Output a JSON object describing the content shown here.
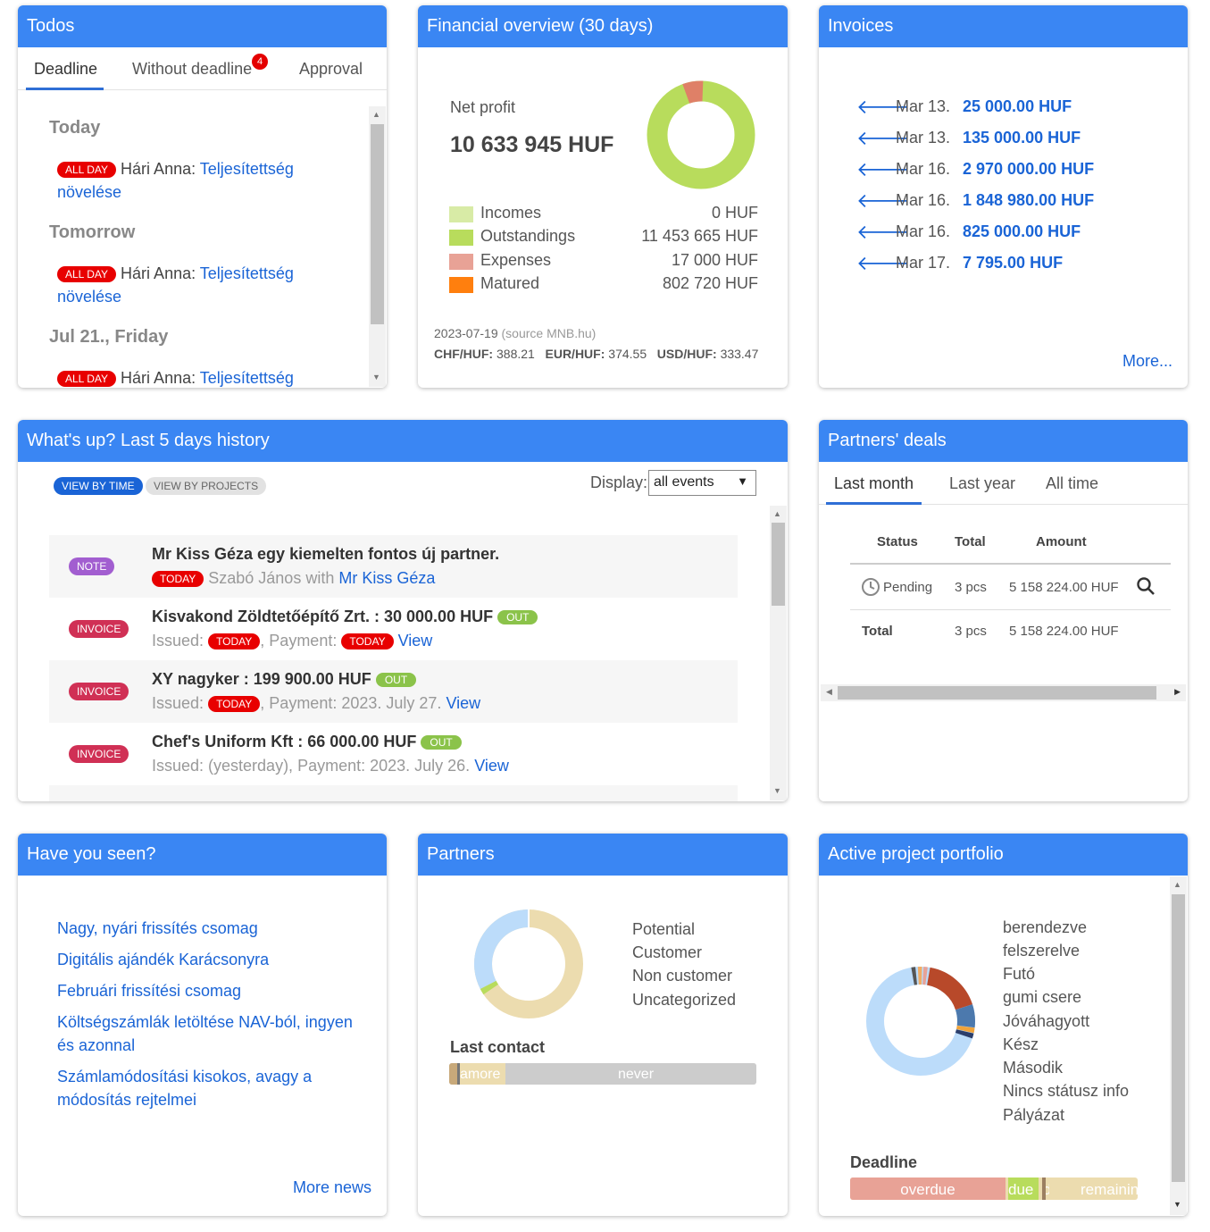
{
  "todos": {
    "title": "Todos",
    "tabs": [
      "Deadline",
      "Without deadline",
      "Approval"
    ],
    "without_deadline_badge": "4",
    "days": [
      {
        "label": "Today",
        "badge": "ALL DAY",
        "person": "Hári Anna:",
        "task": "Teljesítettség növelése"
      },
      {
        "label": "Tomorrow",
        "badge": "ALL DAY",
        "person": "Hári Anna:",
        "task": "Teljesítettség növelése"
      },
      {
        "label": "Jul 21., Friday",
        "badge": "ALL DAY",
        "person": "Hári Anna:",
        "task": "Teljesítettség"
      }
    ]
  },
  "financial": {
    "title": "Financial overview (30 days)",
    "net_profit_label": "Net profit",
    "net_profit_value": "10 633 945 HUF",
    "legend": [
      {
        "label": "Incomes",
        "value": "0 HUF",
        "color": "#d8eba6"
      },
      {
        "label": "Outstandings",
        "value": "11 453 665 HUF",
        "color": "#b8dc5c"
      },
      {
        "label": "Expenses",
        "value": "17 000 HUF",
        "color": "#e8a296"
      },
      {
        "label": "Matured",
        "value": "802 720 HUF",
        "color": "#ff7f0e"
      }
    ],
    "rate_date": "2023-07-19",
    "rate_source": "(source MNB.hu)",
    "rates": [
      {
        "pair": "CHF/HUF:",
        "value": "388.21"
      },
      {
        "pair": "EUR/HUF:",
        "value": "374.55"
      },
      {
        "pair": "USD/HUF:",
        "value": "333.47"
      }
    ]
  },
  "invoices": {
    "title": "Invoices",
    "rows": [
      {
        "date": "Mar 13.",
        "amount": "25 000.00 HUF"
      },
      {
        "date": "Mar 13.",
        "amount": "135 000.00 HUF"
      },
      {
        "date": "Mar 16.",
        "amount": "2 970 000.00 HUF"
      },
      {
        "date": "Mar 16.",
        "amount": "1 848 980.00 HUF"
      },
      {
        "date": "Mar 16.",
        "amount": "825 000.00 HUF"
      },
      {
        "date": "Mar 17.",
        "amount": "7 795.00 HUF"
      }
    ],
    "more": "More..."
  },
  "history": {
    "title": "What's up? Last 5 days history",
    "view_by_time": "VIEW BY TIME",
    "view_by_projects": "VIEW BY PROJECTS",
    "display_label": "Display:",
    "display_value": "all events",
    "events": [
      {
        "type": "NOTE",
        "title": "Mr Kiss Géza egy kiemelten fontos új partner.",
        "today": "TODAY",
        "sub_text": "Szabó János with",
        "sub_link": "Mr Kiss Géza"
      },
      {
        "type": "INVOICE",
        "title": "Kisvakond Zöldtetőépítő Zrt. : 30 000.00 HUF",
        "out": "OUT",
        "issued": "Issued:",
        "today": "TODAY",
        "payment": ", Payment:",
        "today2": "TODAY",
        "view": "View"
      },
      {
        "type": "INVOICE",
        "title": "XY nagyker : 199 900.00 HUF",
        "out": "OUT",
        "issued": "Issued:",
        "today": "TODAY",
        "payment": ", Payment: 2023. July 27.",
        "view": "View"
      },
      {
        "type": "INVOICE",
        "title": "Chef's Uniform Kft : 66 000.00 HUF",
        "out": "OUT",
        "sub_text": "Issued: (yesterday), Payment: 2023. July 26.",
        "view": "View"
      }
    ]
  },
  "deals": {
    "title": "Partners' deals",
    "tabs": [
      "Last month",
      "Last year",
      "All time"
    ],
    "headers": [
      "Status",
      "Total",
      "Amount"
    ],
    "rows": [
      {
        "status": "Pending",
        "total": "3 pcs",
        "amount": "5 158 224.00 HUF"
      }
    ],
    "total_row": {
      "label": "Total",
      "total": "3 pcs",
      "amount": "5 158 224.00 HUF"
    }
  },
  "seen": {
    "title": "Have you seen?",
    "news": [
      "Nagy, nyári frissítés csomag",
      "Digitális ajándék Karácsonyra",
      "Februári frissítési csomag",
      "Költségszámlák letöltése NAV-ból, ingyen és azonnal",
      "Számlamódosítási kisokos, avagy a módosítás rejtelmei"
    ],
    "more": "More news"
  },
  "partners": {
    "title": "Partners",
    "legend": [
      "Potential",
      "Customer",
      "Non customer",
      "Uncategorized"
    ],
    "last_contact": "Last contact",
    "bar_labels": [
      "amore",
      "never"
    ]
  },
  "portfolio": {
    "title": "Active project portfolio",
    "legend": [
      "berendezve",
      "felszerelve",
      "Futó",
      "gumi csere",
      "Jóváhagyott",
      "Kész",
      "Második",
      "Nincs státusz info",
      "Pályázat"
    ],
    "deadline": "Deadline",
    "bar_labels": [
      "overdue",
      "due",
      "d",
      "remainin"
    ]
  },
  "colors": {
    "header": "#3a86f3",
    "link": "#1a64d6",
    "badge_red": "#e80000",
    "note": "#a25ed0",
    "invoice": "#d03055",
    "out": "#8bc34a"
  }
}
